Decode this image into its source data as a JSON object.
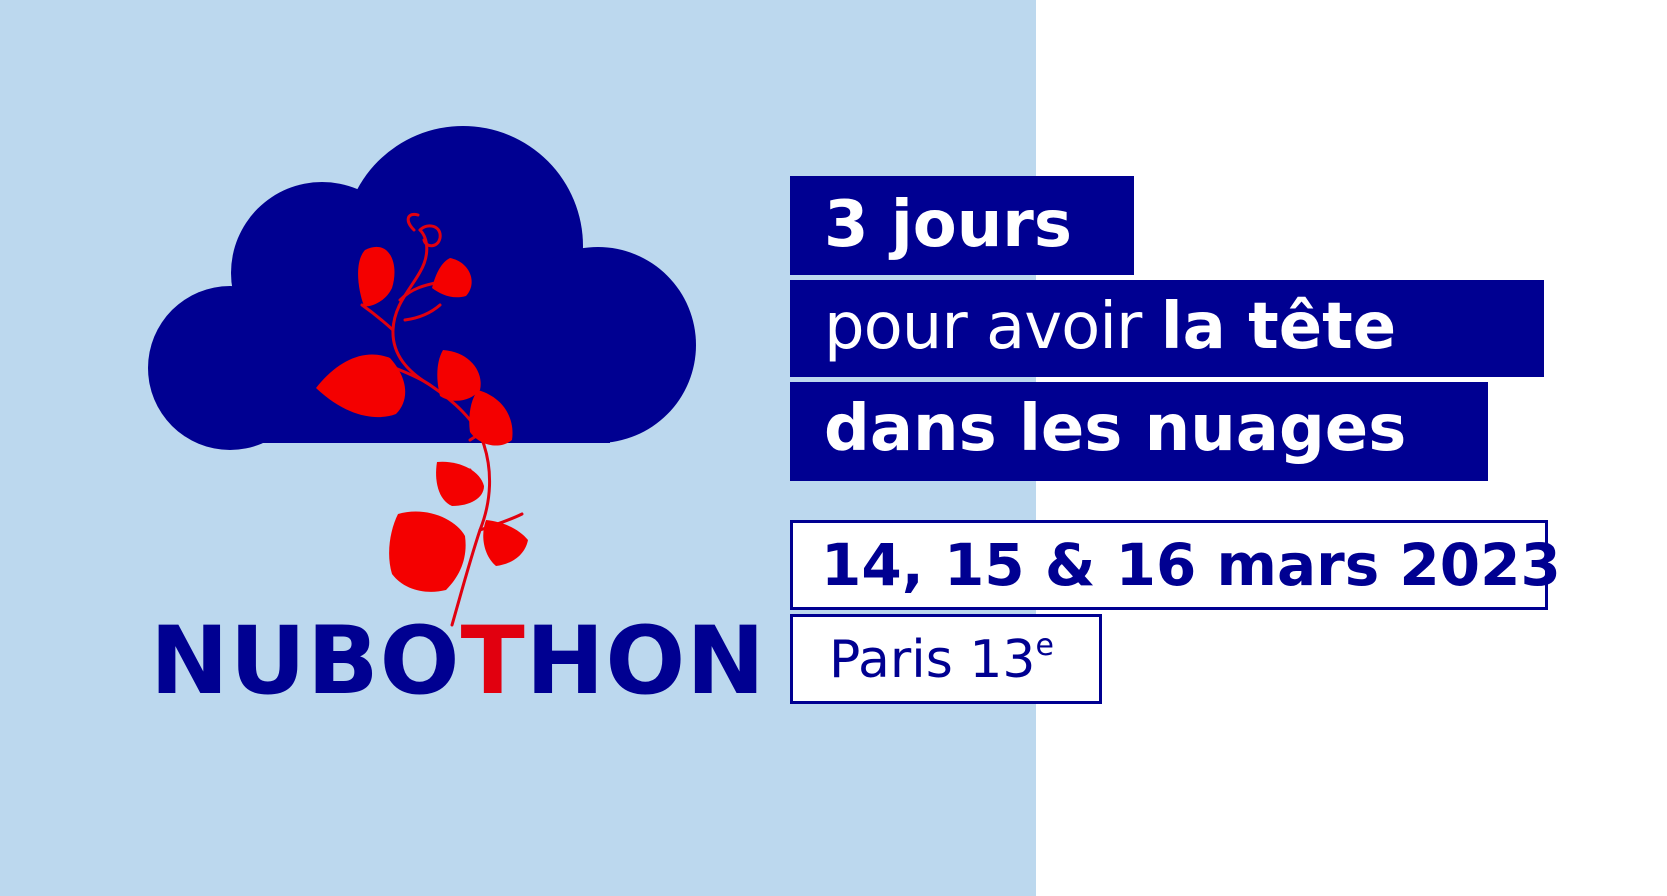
{
  "logo": {
    "name_part1": "NUBO",
    "name_accent": "T",
    "name_part2": "HON",
    "brand_color": "#000091",
    "accent_color": "#e1000f",
    "icon": "cloud-with-vine-icon"
  },
  "headline": {
    "line1": "3 jours",
    "line2_light": "pour avoir ",
    "line2_bold": "la tête",
    "line3": "dans les nuages"
  },
  "event": {
    "dates": "14, 15 & 16 mars 2023",
    "place": "Paris 13",
    "place_suffix": "e"
  },
  "colors": {
    "left_background": "#bcd8ee",
    "right_background": "#ffffff"
  }
}
